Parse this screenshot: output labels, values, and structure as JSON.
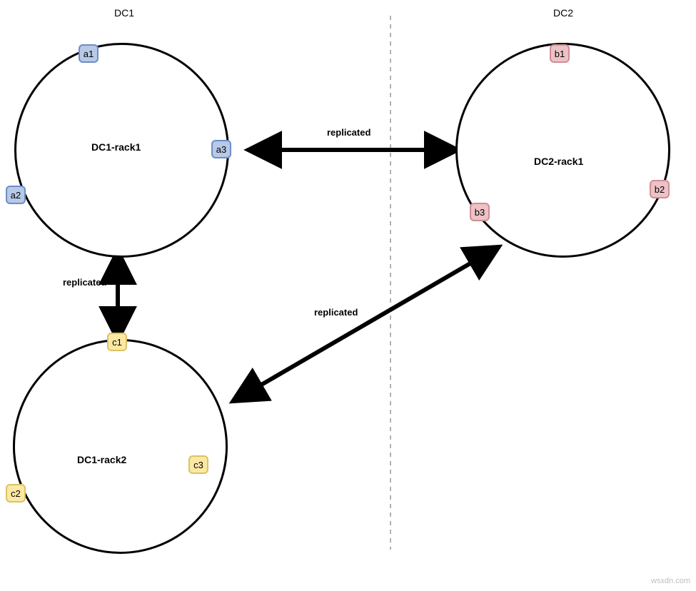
{
  "headers": {
    "dc1": "DC1",
    "dc2": "DC2"
  },
  "rings": {
    "dc1_rack1": {
      "label": "DC1-rack1"
    },
    "dc1_rack2": {
      "label": "DC1-rack2"
    },
    "dc2_rack1": {
      "label": "DC2-rack1"
    }
  },
  "nodes": {
    "a1": "a1",
    "a2": "a2",
    "a3": "a3",
    "b1": "b1",
    "b2": "b2",
    "b3": "b3",
    "c1": "c1",
    "c2": "c2",
    "c3": "c3"
  },
  "edges": {
    "rep1": "replicated",
    "rep2": "replicated",
    "rep3": "replicated"
  },
  "colors": {
    "blue_fill": "#b7c9e6",
    "blue_border": "#6b8ec7",
    "pink_fill": "#ecc2c7",
    "pink_border": "#cf8d94",
    "yellow_fill": "#fbe9a3",
    "yellow_border": "#dbc264"
  },
  "watermark": "wsxdn.com"
}
